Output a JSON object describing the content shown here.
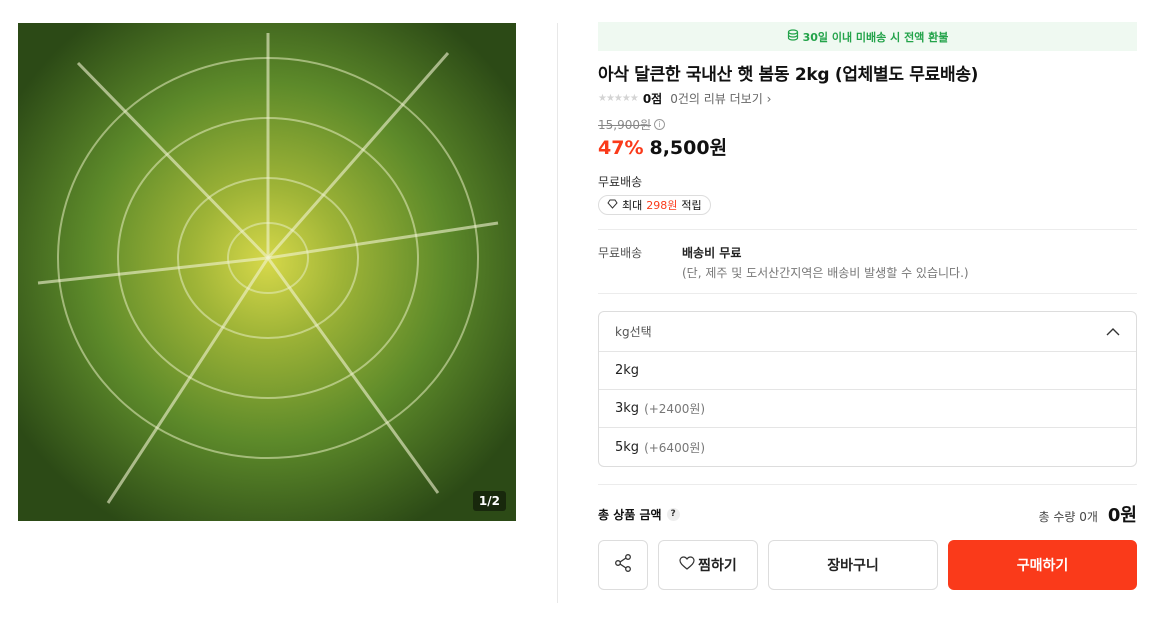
{
  "gallery": {
    "counter": "1/2",
    "image_desc_icon": "cabbage-photo"
  },
  "banner": {
    "icon": "coin-stack-icon",
    "text": "30일 이내 미배송 시 전액 환불"
  },
  "product": {
    "title": "아삭 달큰한 국내산 햇 봄동 2kg (업체별도 무료배송)",
    "stars": "★★★★★",
    "score": "0점",
    "review_link": "0건의 리뷰 더보기 ›",
    "original_price": "15,900원",
    "discount": "47%",
    "price": "8,500원"
  },
  "shipping": {
    "label": "무료배송",
    "reward_prefix": "최대",
    "reward_amount": "298원",
    "reward_suffix": "적립",
    "row_label": "무료배송",
    "fee": "배송비 무료",
    "note": "(단, 제주 및 도서산간지역은 배송비 발생할 수 있습니다.)"
  },
  "option_select": {
    "placeholder": "kg선택",
    "options": [
      {
        "label": "2kg",
        "extra": ""
      },
      {
        "label": "3kg",
        "extra": "(+2400원)"
      },
      {
        "label": "5kg",
        "extra": "(+6400원)"
      }
    ]
  },
  "total": {
    "label": "총 상품 금액",
    "help": "?",
    "qty": "총 수량 0개",
    "price": "0원"
  },
  "buttons": {
    "wish": "찜하기",
    "cart": "장바구니",
    "buy": "구매하기"
  },
  "colors": {
    "accent": "#fa3a1a",
    "banner_green": "#23a34a"
  }
}
